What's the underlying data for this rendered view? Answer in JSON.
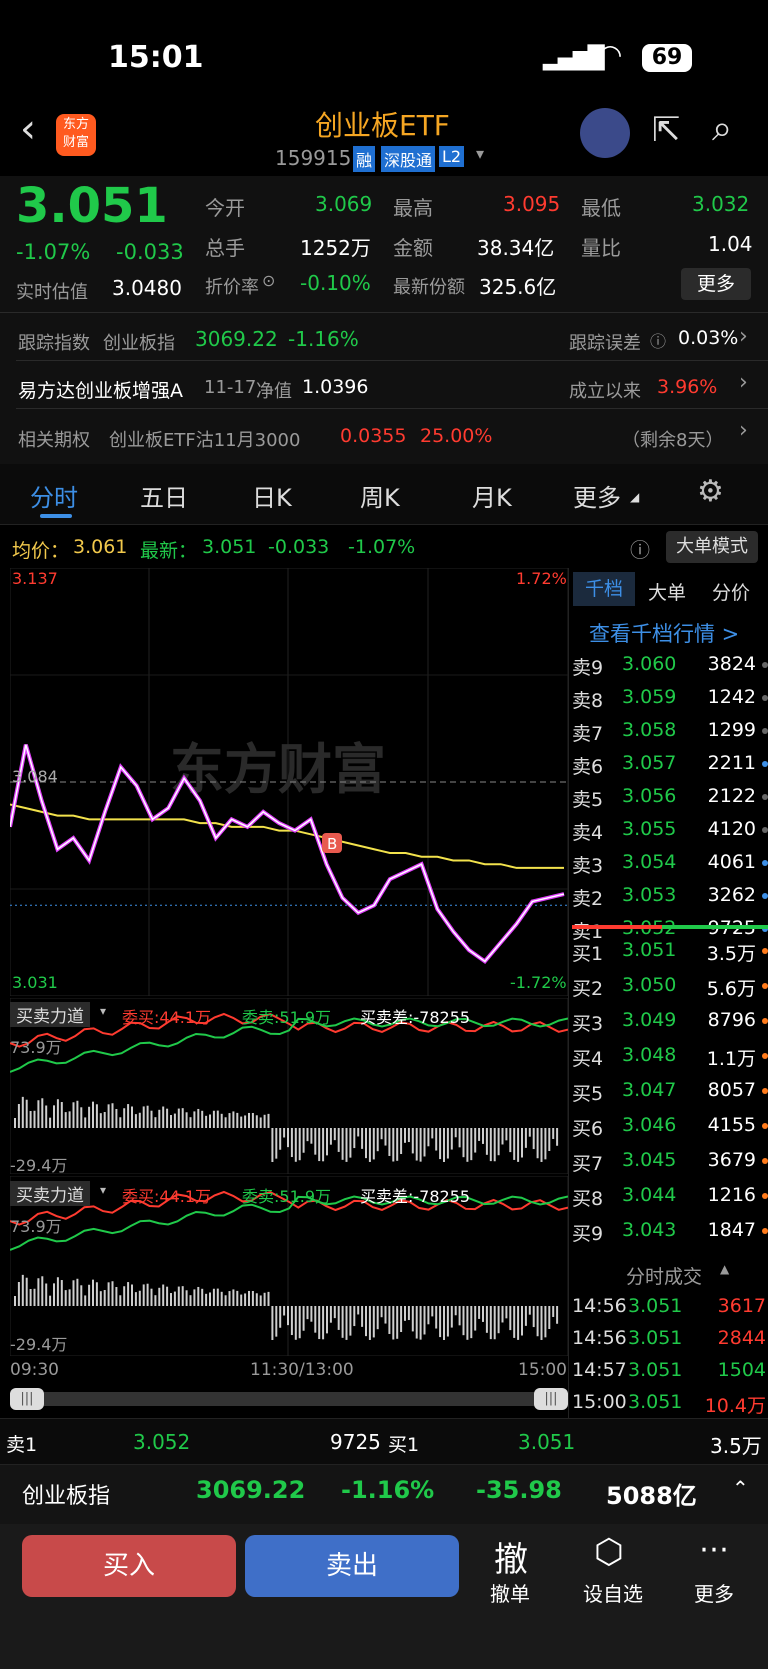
{
  "status": {
    "time": "15:01",
    "battery": "69"
  },
  "header": {
    "logo_text": "东方\n财富",
    "title": "创业板ETF",
    "code": "159915",
    "tags": [
      "融",
      "深股通",
      "L2"
    ]
  },
  "quote": {
    "price": "3.051",
    "pct": "-1.07%",
    "chg": "-0.033",
    "realtime_est_label": "实时估值",
    "realtime_est_value": "3.0480",
    "open_label": "今开",
    "open": "3.069",
    "high_label": "最高",
    "high": "3.095",
    "low_label": "最低",
    "low": "3.032",
    "volume_label": "总手",
    "volume": "1252万",
    "amount_label": "金额",
    "amount": "38.34亿",
    "ratio_label": "量比",
    "ratio": "1.04",
    "premium_label": "折价率",
    "premium": "-0.10%",
    "shares_label": "最新份额",
    "shares": "325.6亿",
    "more_button": "更多"
  },
  "tracking": {
    "label": "跟踪指数",
    "index_name": "创业板指",
    "index_value": "3069.22",
    "index_pct": "-1.16%",
    "error_label": "跟踪误差",
    "error_value": "0.03%"
  },
  "fund": {
    "name": "易方达创业板增强A",
    "date": "11-17",
    "nav_label": "净值",
    "nav": "1.0396",
    "since_label": "成立以来",
    "since_value": "3.96%"
  },
  "option": {
    "label": "相关期权",
    "name": "创业板ETF沽11月3000",
    "price": "0.0355",
    "pct": "25.00%",
    "remain": "（剩余8天）"
  },
  "tabs": [
    "分时",
    "五日",
    "日K",
    "周K",
    "月K",
    "更多"
  ],
  "chart_bar": {
    "avg_label": "均价：",
    "avg": "3.061",
    "latest_label": "最新：",
    "latest": "3.051",
    "latest_chg": "-0.033",
    "latest_pct": "-1.07%",
    "big_order_mode": "大单模式"
  },
  "chart_data": {
    "type": "line",
    "title": "",
    "ylim": [
      3.031,
      3.137
    ],
    "y_top_label": "3.137",
    "y_bottom_label": "3.031",
    "pct_top_label": "1.72%",
    "pct_bottom_label": "-1.72%",
    "prev_close": 3.084,
    "prev_close_label": "3.084",
    "watermark": "东方财富",
    "marker": "B",
    "x_labels": [
      "09:30",
      "11:30/13:00",
      "15:00"
    ],
    "series": [
      {
        "values": [
          3.072,
          3.094,
          3.079,
          3.066,
          3.069,
          3.063,
          3.076,
          3.088,
          3.083,
          3.074,
          3.077,
          3.085,
          3.079,
          3.069,
          3.074,
          3.072,
          3.076,
          3.073,
          3.071,
          3.074,
          3.062,
          3.053,
          3.049,
          3.051,
          3.058,
          3.06,
          3.062,
          3.05,
          3.044,
          3.039,
          3.036,
          3.041,
          3.046,
          3.052,
          3.053,
          3.054
        ]
      },
      {
        "values": [
          3.078,
          3.077,
          3.076,
          3.075,
          3.075,
          3.074,
          3.074,
          3.074,
          3.074,
          3.074,
          3.074,
          3.074,
          3.073,
          3.073,
          3.072,
          3.072,
          3.072,
          3.071,
          3.071,
          3.07,
          3.069,
          3.068,
          3.067,
          3.066,
          3.065,
          3.065,
          3.064,
          3.064,
          3.063,
          3.063,
          3.062,
          3.062,
          3.061,
          3.061,
          3.061,
          3.061
        ]
      }
    ]
  },
  "force1": {
    "title": "买卖力道",
    "buy": "委买:44.1万",
    "sell": "委卖:51.9万",
    "diff": "买卖差:-78255",
    "top": "73.9万",
    "bottom": "-29.4万"
  },
  "force2": {
    "title": "买卖力道",
    "buy": "委买:44.1万",
    "sell": "委卖:51.9万",
    "diff": "买卖差:-78255",
    "top": "73.9万",
    "bottom": "-29.4万"
  },
  "orderbook": {
    "tabs": [
      "千档",
      "大单",
      "分价"
    ],
    "link": "查看千档行情 >",
    "asks": [
      {
        "label": "卖9",
        "price": "3.060",
        "vol": "3824"
      },
      {
        "label": "卖8",
        "price": "3.059",
        "vol": "1242"
      },
      {
        "label": "卖7",
        "price": "3.058",
        "vol": "1299"
      },
      {
        "label": "卖6",
        "price": "3.057",
        "vol": "2211"
      },
      {
        "label": "卖5",
        "price": "3.056",
        "vol": "2122"
      },
      {
        "label": "卖4",
        "price": "3.055",
        "vol": "4120"
      },
      {
        "label": "卖3",
        "price": "3.054",
        "vol": "4061"
      },
      {
        "label": "卖2",
        "price": "3.053",
        "vol": "3262"
      },
      {
        "label": "卖1",
        "price": "3.052",
        "vol": "9725"
      }
    ],
    "bids": [
      {
        "label": "买1",
        "price": "3.051",
        "vol": "3.5万"
      },
      {
        "label": "买2",
        "price": "3.050",
        "vol": "5.6万"
      },
      {
        "label": "买3",
        "price": "3.049",
        "vol": "8796"
      },
      {
        "label": "买4",
        "price": "3.048",
        "vol": "1.1万"
      },
      {
        "label": "买5",
        "price": "3.047",
        "vol": "8057"
      },
      {
        "label": "买6",
        "price": "3.046",
        "vol": "4155"
      },
      {
        "label": "买7",
        "price": "3.045",
        "vol": "3679"
      },
      {
        "label": "买8",
        "price": "3.044",
        "vol": "1216"
      },
      {
        "label": "买9",
        "price": "3.043",
        "vol": "1847"
      }
    ],
    "ticks_title": "分时成交",
    "ticks": [
      {
        "time": "14:56",
        "price": "3.051",
        "vol": "3617"
      },
      {
        "time": "14:56",
        "price": "3.051",
        "vol": "2844"
      },
      {
        "time": "14:57",
        "price": "3.051",
        "vol": "1504"
      },
      {
        "time": "15:00",
        "price": "3.051",
        "vol": "10.4万"
      }
    ]
  },
  "bottom_quote": {
    "sell_label": "卖1",
    "sell_price": "3.052",
    "sell_vol": "9725",
    "buy_label": "买1",
    "buy_price": "3.051",
    "buy_vol": "3.5万"
  },
  "index_bar": {
    "name": "创业板指",
    "value": "3069.22",
    "pct": "-1.16%",
    "chg": "-35.98",
    "amount": "5088亿"
  },
  "actions": {
    "buy": "买入",
    "sell": "卖出",
    "cancel_glyph": "撤",
    "cancel": "撤单",
    "watch": "设自选",
    "more": "更多"
  }
}
